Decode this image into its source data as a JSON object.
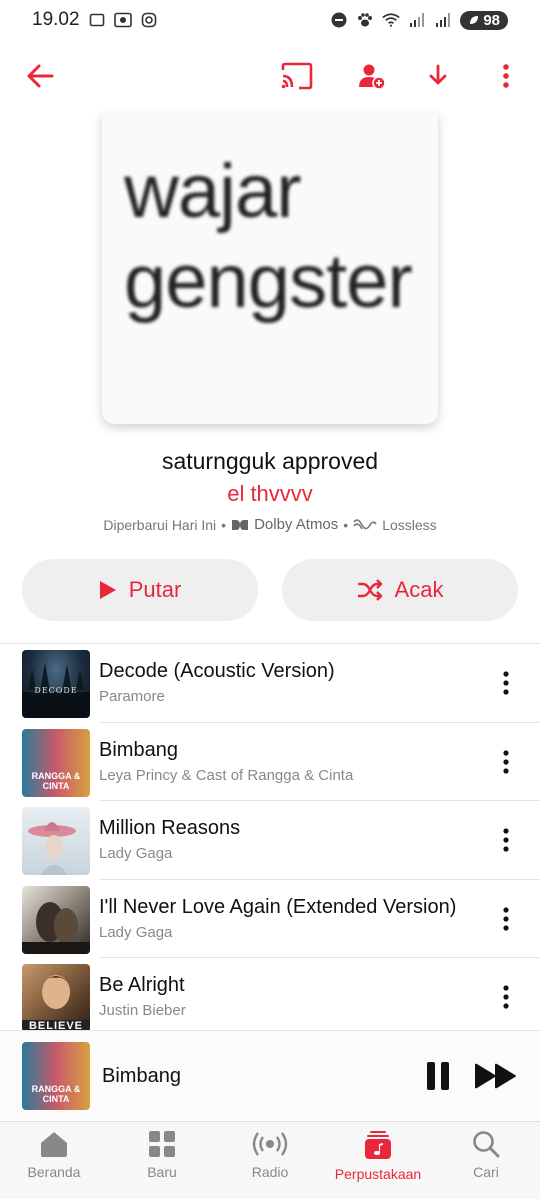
{
  "status_bar": {
    "time": "19.02",
    "battery": "98"
  },
  "playlist": {
    "artwork_text_line1": "wajar",
    "artwork_text_line2": "gengster",
    "title": "saturngguk approved",
    "owner": "el thvvvv",
    "updated": "Diperbarui Hari Ini",
    "dolby_label": "Dolby Atmos",
    "lossless_label": "Lossless"
  },
  "actions": {
    "play_label": "Putar",
    "shuffle_label": "Acak"
  },
  "tracks": [
    {
      "title": "Decode (Acoustic Version)",
      "artist": "Paramore",
      "thumb_text": "DECODE"
    },
    {
      "title": "Bimbang",
      "artist": "Leya Princy & Cast of Rangga & Cinta",
      "thumb_text": "RANGGA & CINTA"
    },
    {
      "title": "Million Reasons",
      "artist": "Lady Gaga",
      "thumb_text": ""
    },
    {
      "title": "I'll Never Love Again (Extended Version)",
      "artist": "Lady Gaga",
      "thumb_text": ""
    },
    {
      "title": "Be Alright",
      "artist": "Justin Bieber",
      "thumb_text": "BELIEVE"
    }
  ],
  "now_playing": {
    "title": "Bimbang",
    "thumb_text": "RANGGA & CINTA"
  },
  "tabs": [
    {
      "label": "Beranda",
      "icon": "home-icon"
    },
    {
      "label": "Baru",
      "icon": "grid-icon"
    },
    {
      "label": "Radio",
      "icon": "radio-icon"
    },
    {
      "label": "Perpustakaan",
      "icon": "library-icon"
    },
    {
      "label": "Cari",
      "icon": "search-icon"
    }
  ],
  "colors": {
    "accent": "#e8283a",
    "button_bg": "#efeff0",
    "secondary_text": "#888888"
  }
}
